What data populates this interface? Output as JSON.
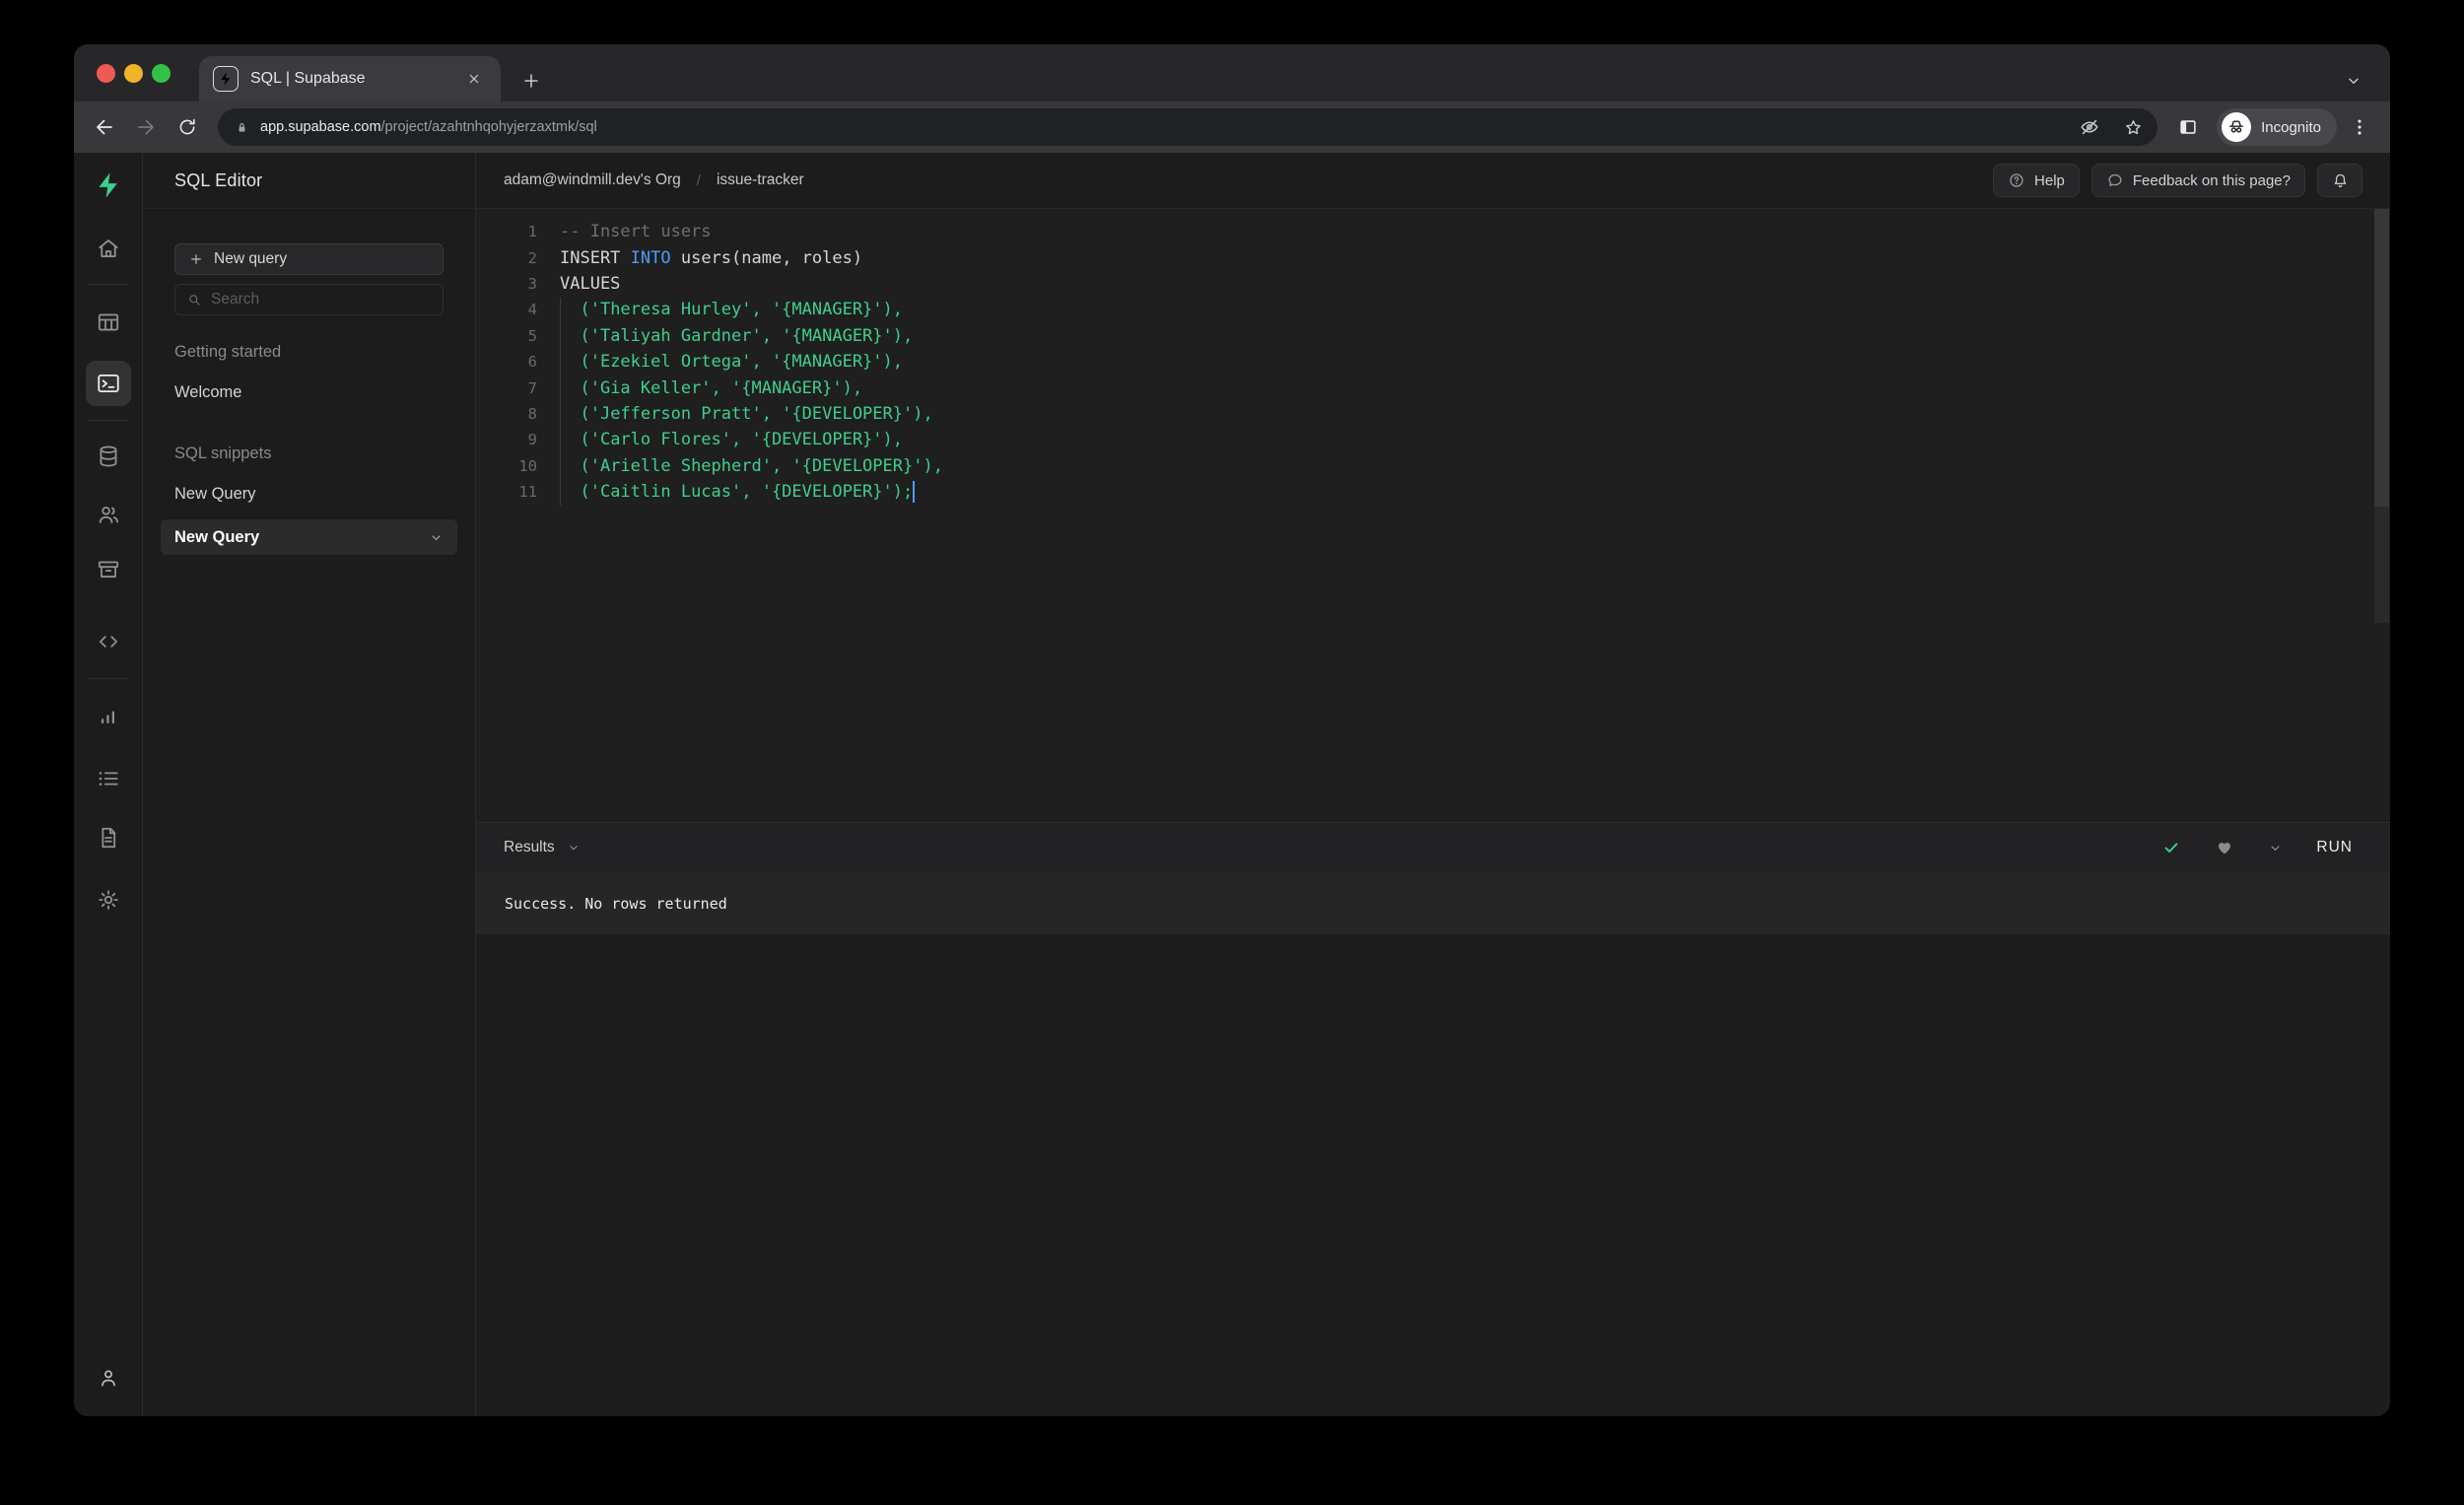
{
  "browser": {
    "tab_title": "SQL | Supabase",
    "url_host": "app.supabase.com",
    "url_path": "/project/azahtnhqohyjerzaxtmk/sql",
    "incognito_label": "Incognito",
    "traffic_lights": [
      "#ef5a52",
      "#f0b428",
      "#32c146"
    ]
  },
  "sidebar": {
    "logo_icon": "supabase-logo",
    "icons": [
      "home",
      "table-editor",
      "sql-editor",
      "database",
      "auth",
      "storage",
      "code",
      "reports",
      "logs",
      "docs",
      "settings"
    ],
    "active_icon": "sql-editor",
    "account_icon": "account"
  },
  "header": {
    "title": "SQL Editor",
    "breadcrumb": {
      "org": "adam@windmill.dev's Org",
      "separator": "/",
      "project": "issue-tracker"
    },
    "help_label": "Help",
    "feedback_label": "Feedback on this page?"
  },
  "panel": {
    "new_query_button": "New query",
    "search_placeholder": "Search",
    "sections": [
      {
        "label": "Getting started",
        "items": [
          {
            "label": "Welcome",
            "active": false
          }
        ]
      },
      {
        "label": "SQL snippets",
        "items": [
          {
            "label": "New Query",
            "active": false
          },
          {
            "label": "New Query",
            "active": true
          }
        ]
      }
    ]
  },
  "editor": {
    "lines": [
      {
        "n": 1,
        "segments": [
          {
            "t": "-- Insert users",
            "s": "comment"
          }
        ]
      },
      {
        "n": 2,
        "segments": [
          {
            "t": "INSERT ",
            "s": "plain"
          },
          {
            "t": "INTO",
            "s": "keyword"
          },
          {
            "t": " users(name, roles)",
            "s": "plain"
          }
        ]
      },
      {
        "n": 3,
        "segments": [
          {
            "t": "VALUES",
            "s": "plain"
          }
        ]
      },
      {
        "n": 4,
        "segments": [
          {
            "t": "  ",
            "s": "plain"
          },
          {
            "t": "('Theresa Hurley', '{MANAGER}'),",
            "s": "string"
          }
        ]
      },
      {
        "n": 5,
        "segments": [
          {
            "t": "  ",
            "s": "plain"
          },
          {
            "t": "('Taliyah Gardner', '{MANAGER}'),",
            "s": "string"
          }
        ]
      },
      {
        "n": 6,
        "segments": [
          {
            "t": "  ",
            "s": "plain"
          },
          {
            "t": "('Ezekiel Ortega', '{MANAGER}'),",
            "s": "string"
          }
        ]
      },
      {
        "n": 7,
        "segments": [
          {
            "t": "  ",
            "s": "plain"
          },
          {
            "t": "('Gia Keller', '{MANAGER}'),",
            "s": "string"
          }
        ]
      },
      {
        "n": 8,
        "segments": [
          {
            "t": "  ",
            "s": "plain"
          },
          {
            "t": "('Jefferson Pratt', '{DEVELOPER}'),",
            "s": "string"
          }
        ]
      },
      {
        "n": 9,
        "segments": [
          {
            "t": "  ",
            "s": "plain"
          },
          {
            "t": "('Carlo Flores', '{DEVELOPER}'),",
            "s": "string"
          }
        ]
      },
      {
        "n": 10,
        "segments": [
          {
            "t": "  ",
            "s": "plain"
          },
          {
            "t": "('Arielle Shepherd', '{DEVELOPER}'),",
            "s": "string"
          }
        ]
      },
      {
        "n": 11,
        "segments": [
          {
            "t": "  ",
            "s": "plain"
          },
          {
            "t": "('Caitlin Lucas', '{DEVELOPER}');",
            "s": "string"
          }
        ]
      }
    ]
  },
  "results": {
    "label": "Results",
    "run_label": "RUN",
    "message": "Success. No rows returned"
  },
  "colors": {
    "brand_green": "#3ecf8e",
    "keyword_blue": "#4e9bfa",
    "string_green": "#3ecf8e"
  }
}
